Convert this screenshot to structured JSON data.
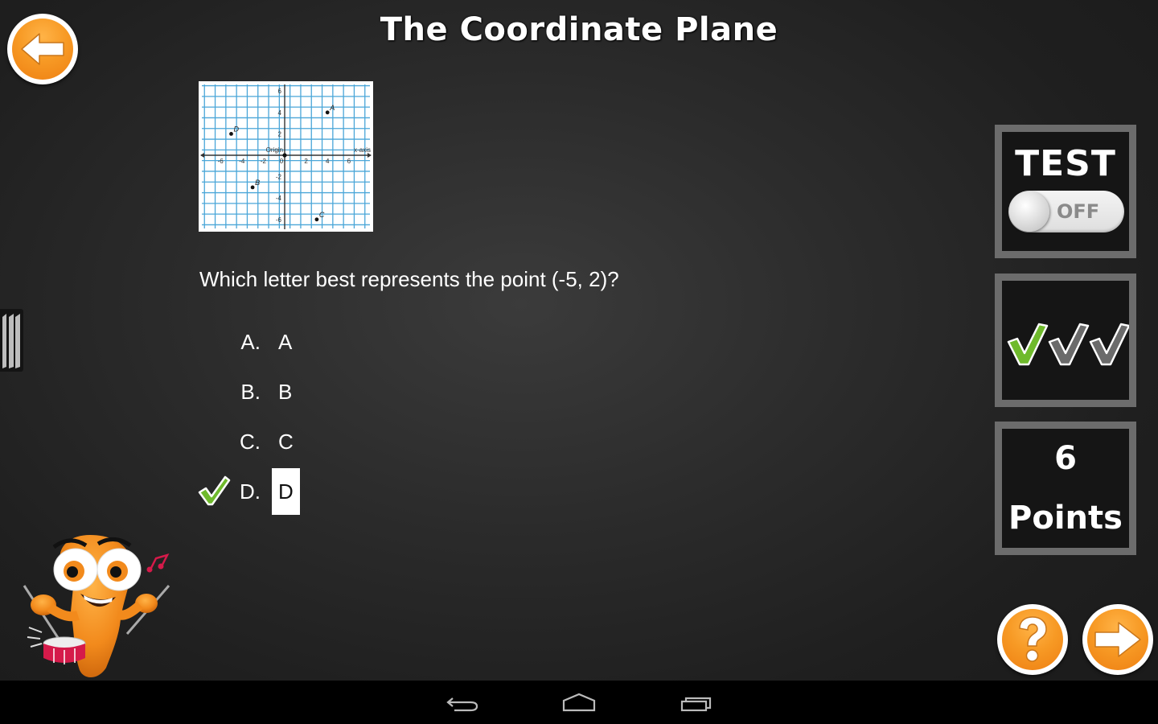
{
  "header": {
    "title": "The Coordinate Plane",
    "back_icon": "arrow-left-icon"
  },
  "figure": {
    "x_axis_label": "x-axis",
    "origin_label": "Origin",
    "x_ticks": [
      "-6",
      "-4",
      "-2",
      "0",
      "2",
      "4",
      "6"
    ],
    "y_ticks": [
      "6",
      "4",
      "2",
      "-2",
      "-4",
      "-6"
    ],
    "points": [
      {
        "label": "A",
        "x": 4,
        "y": 4
      },
      {
        "label": "B",
        "x": -3,
        "y": -3
      },
      {
        "label": "C",
        "x": 3,
        "y": -6
      },
      {
        "label": "D",
        "x": -5,
        "y": 2
      }
    ],
    "grid_color": "#4aa6d8",
    "axis_color": "#333333"
  },
  "question": {
    "text": "Which letter best represents the point (-5, 2)?",
    "options": [
      {
        "letter": "A.",
        "value": "A",
        "selected": false
      },
      {
        "letter": "B.",
        "value": "B",
        "selected": false
      },
      {
        "letter": "C.",
        "value": "C",
        "selected": false
      },
      {
        "letter": "D.",
        "value": "D",
        "selected": true
      }
    ],
    "correct_option": "D"
  },
  "side_panel": {
    "test_label": "TEST",
    "test_toggle_state": "OFF",
    "streak": {
      "completed": 1,
      "total": 3,
      "active_color": "#6fba2c",
      "inactive_color": "#6b6b6b"
    },
    "points_value": "6",
    "points_label": "Points"
  },
  "buttons": {
    "help_icon": "question-mark-icon",
    "next_icon": "arrow-right-icon"
  },
  "colors": {
    "accent_orange": "#f79a25",
    "check_green": "#6fba2c"
  },
  "navbar": {
    "back_icon": "nav-back-icon",
    "home_icon": "nav-home-icon",
    "recents_icon": "nav-recents-icon"
  }
}
